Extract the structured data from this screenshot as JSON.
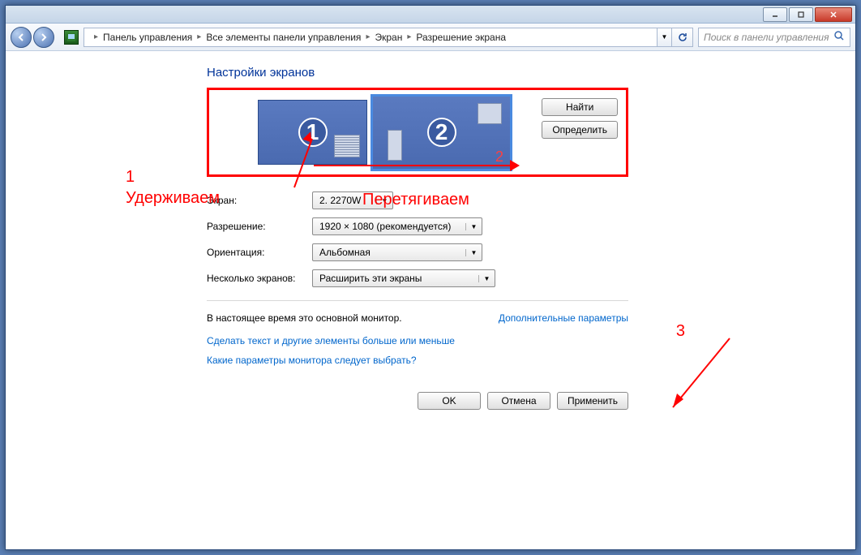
{
  "breadcrumb": {
    "items": [
      "Панель управления",
      "Все элементы панели управления",
      "Экран",
      "Разрешение экрана"
    ]
  },
  "search": {
    "placeholder": "Поиск в панели управления"
  },
  "page": {
    "title": "Настройки экранов"
  },
  "monitors": {
    "m1": {
      "number": "1"
    },
    "m2": {
      "number": "2",
      "corner_label": "2"
    },
    "find_btn": "Найти",
    "detect_btn": "Определить"
  },
  "form": {
    "display_label": "Экран:",
    "display_value": "2. 2270W",
    "resolution_label": "Разрешение:",
    "resolution_value": "1920 × 1080 (рекомендуется)",
    "orientation_label": "Ориентация:",
    "orientation_value": "Альбомная",
    "multi_label": "Несколько экранов:",
    "multi_value": "Расширить эти экраны"
  },
  "status": {
    "primary_text": "В настоящее время это основной монитор.",
    "advanced_link": "Дополнительные параметры"
  },
  "links": {
    "text_size": "Сделать текст и другие элементы больше или меньше",
    "which_monitor": "Какие параметры монитора следует выбрать?"
  },
  "buttons": {
    "ok": "OK",
    "cancel": "Отмена",
    "apply": "Применить"
  },
  "annotations": {
    "n1": "1",
    "n2": "2",
    "n3": "3",
    "hold": "Удерживаем",
    "drag": "Перетягиваем"
  }
}
